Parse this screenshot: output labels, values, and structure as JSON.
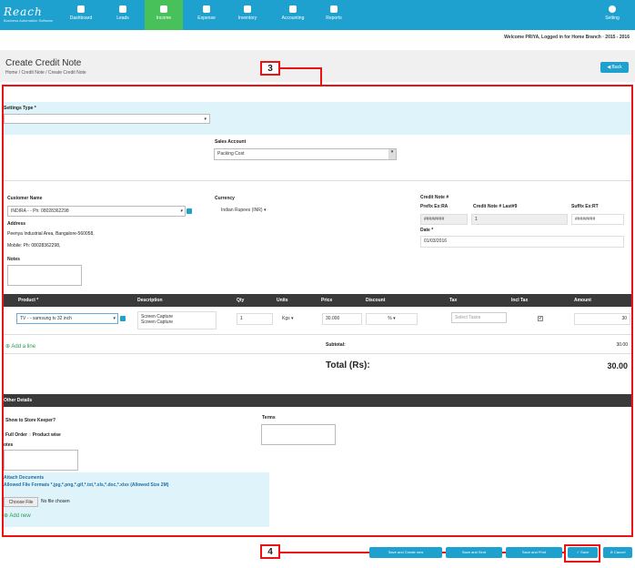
{
  "app": {
    "logo": "Reach",
    "tagline": "Business Automation Software"
  },
  "nav": {
    "items": [
      {
        "label": "Dashboard"
      },
      {
        "label": "Leads"
      },
      {
        "label": "Income"
      },
      {
        "label": "Expense"
      },
      {
        "label": "Inventory"
      },
      {
        "label": "Accounting"
      },
      {
        "label": "Reports"
      }
    ],
    "settings": "Setting"
  },
  "welcome": "Welcome PRIYA, Logged in for Home Branch · 2015 - 2016",
  "page": {
    "title": "Create Credit Note",
    "crumb1": "Home",
    "crumb2": "Credit Note",
    "crumb3": "Create Credit Note",
    "back": "Back"
  },
  "callouts": {
    "c3": "3",
    "c4": "4"
  },
  "form": {
    "settings_type_label": "Settings Type *",
    "sales_account_label": "Sales Account",
    "sales_account_value": "Packing Cost",
    "customer_label": "Customer Name",
    "customer_value": "INDIRA - - Ph: 08028362298",
    "address_label": "Address",
    "address_value": "Peenya Industrial Area, Bangalore-560058,",
    "mobile_value": "Mobile: Ph: 08028362298,",
    "notes_label": "Notes",
    "currency_label": "Currency",
    "currency_value": "Indian Rupees (INR)",
    "credit_note_label": "Credit Note #",
    "prefix_label": "Prefix Ex:RA",
    "last_label": "Credit Note # Last#9",
    "suffix_label": "Suffix Ex:RT",
    "prefix_value": "########",
    "last_value": "1",
    "suffix_value": "########",
    "date_label": "Date *",
    "date_value": "01/03/2016"
  },
  "table": {
    "headers": [
      "Product *",
      "Description",
      "Qty",
      "Units",
      "Price",
      "Discount",
      "Tax",
      "Incl Tax",
      "Amount"
    ],
    "row": {
      "product": "TV - - samsung tv 32 inch",
      "desc1": "Screen Capture",
      "desc2": "Screen Capture",
      "qty": "1",
      "units": "Kgs",
      "price": "30.000",
      "discount_unit": "%",
      "tax_placeholder": "Select Taxes",
      "amount": "30"
    },
    "add_line": "Add a line",
    "subtotal_label": "Subtotal:",
    "subtotal_value": "30.00",
    "total_label": "Total (Rs):",
    "total_value": "30.00"
  },
  "other": {
    "header": "Other Details",
    "store_keeper": "Show to Store Keeper?",
    "full_order": "Full Order",
    "product_wise": "Product wise",
    "notes": "otes",
    "terms": "Terms",
    "attach_title": "Attach Documents",
    "attach_formats": "Allowed File Formats *.jpg,*.png,*.gif,*.txt,*.xls,*.doc,*.xlsx (Allowed Size 2M)",
    "choose_file": "Choose File",
    "no_file": "No file chosen",
    "add_new": "Add new"
  },
  "footer": {
    "btn1": "Save and Create new",
    "btn2": "Save and Sent",
    "btn3": "Save and Print",
    "save": "Save",
    "cancel": "Cancel"
  }
}
